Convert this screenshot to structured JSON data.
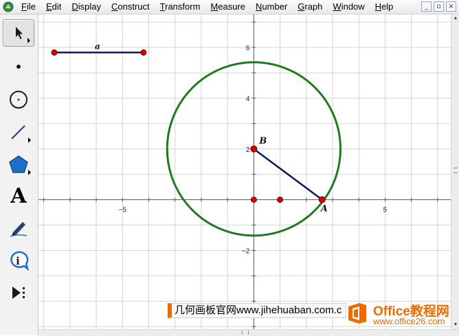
{
  "menu": [
    "File",
    "Edit",
    "Display",
    "Construct",
    "Transform",
    "Measure",
    "Number",
    "Graph",
    "Window",
    "Help"
  ],
  "window_controls": {
    "minimize": "_",
    "restore": "▫",
    "close": "×"
  },
  "toolbox": [
    {
      "name": "arrow-tool",
      "icon": "arrow-selection-icon",
      "selected": true
    },
    {
      "name": "point-tool",
      "icon": "point-icon"
    },
    {
      "name": "compass-tool",
      "icon": "circle-compass-icon"
    },
    {
      "name": "straightedge-tool",
      "icon": "segment-icon"
    },
    {
      "name": "polygon-tool",
      "icon": "pentagon-icon"
    },
    {
      "name": "text-tool",
      "icon": "text-icon",
      "glyph": "A"
    },
    {
      "name": "marker-tool",
      "icon": "marker-pen-icon"
    },
    {
      "name": "information-tool",
      "icon": "information-icon",
      "glyph": "i"
    },
    {
      "name": "custom-tool",
      "icon": "custom-tools-icon"
    }
  ],
  "graph": {
    "x_range": [
      -8.2,
      7.5
    ],
    "y_range": [
      -5.1,
      7.3
    ],
    "x_tick_labels": [
      "−5",
      "5"
    ],
    "y_tick_labels": [
      "6",
      "4",
      "2",
      "−2"
    ],
    "circle": {
      "center": [
        0,
        2
      ],
      "radius": 3.3,
      "color": "#1f7a1f"
    },
    "segment_BA": {
      "from": [
        0,
        2
      ],
      "to": [
        2.6,
        0
      ],
      "color": "#12115e"
    },
    "point_B": {
      "label": "B",
      "x": 0,
      "y": 2
    },
    "point_A": {
      "label": "A",
      "x": 2.6,
      "y": 0
    },
    "extra_points": [
      [
        0,
        0
      ],
      [
        1,
        0
      ]
    ],
    "segment_a": {
      "label": "a",
      "from": [
        -7.6,
        5.8
      ],
      "to": [
        -4.2,
        5.8
      ],
      "color": "#12115e"
    },
    "point_color": "#d40000"
  },
  "watermark": {
    "text": "几何画板官网www.jihehuaban.com.c",
    "logo_brand": "Office教程网",
    "logo_url": "www.office26.com"
  }
}
